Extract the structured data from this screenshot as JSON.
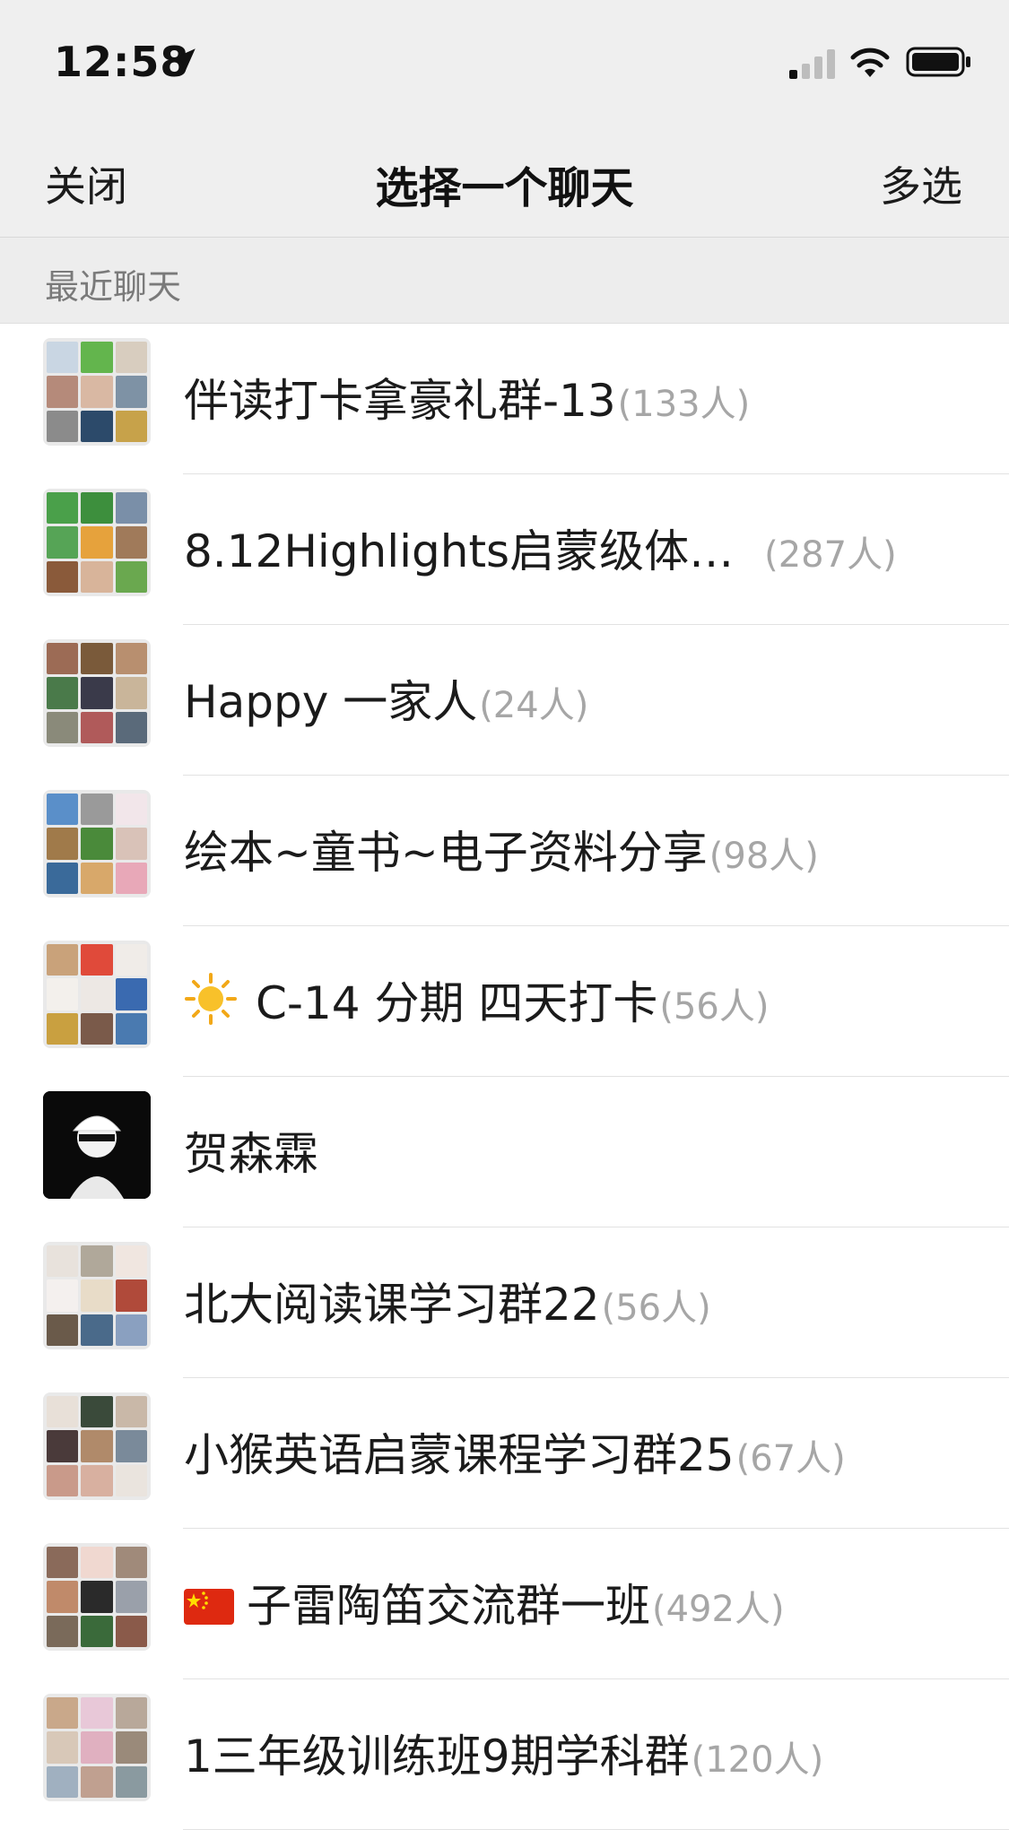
{
  "status_bar": {
    "time": "12:58",
    "icons": [
      "location-arrow-icon",
      "signal-icon",
      "wifi-icon",
      "battery-icon"
    ]
  },
  "nav": {
    "close_label": "关闭",
    "title": "选择一个聊天",
    "multi_label": "多选"
  },
  "section": {
    "label": "最近聊天"
  },
  "chats": [
    {
      "title": "伴读打卡拿豪礼群-13",
      "count": "(133人)"
    },
    {
      "title": "8.12Highlights启蒙级体…",
      "count": "(287人)"
    },
    {
      "title": "Happy 一家人",
      "count": "(24人)"
    },
    {
      "title": "绘本~童书~电子资料分享",
      "count": "(98人)"
    },
    {
      "title": "C-14 分期  四天打卡",
      "count": "(56人)",
      "prefix_icon": "sun-icon"
    },
    {
      "title": "贺森霖",
      "count": ""
    },
    {
      "title": "北大阅读课学习群22",
      "count": "(56人)"
    },
    {
      "title": "小猴英语启蒙课程学习群25",
      "count": "(67人)"
    },
    {
      "title": "子雷陶笛交流群一班",
      "count": "(492人)",
      "prefix_icon": "china-flag-icon"
    },
    {
      "title": "1三年级训练班9期学科群",
      "count": "(120人)"
    }
  ],
  "colors": {
    "topbar_bg": "#efefef",
    "section_bg": "#ededed",
    "count_text": "#a6a6a6",
    "divider": "#e2e2e2"
  }
}
